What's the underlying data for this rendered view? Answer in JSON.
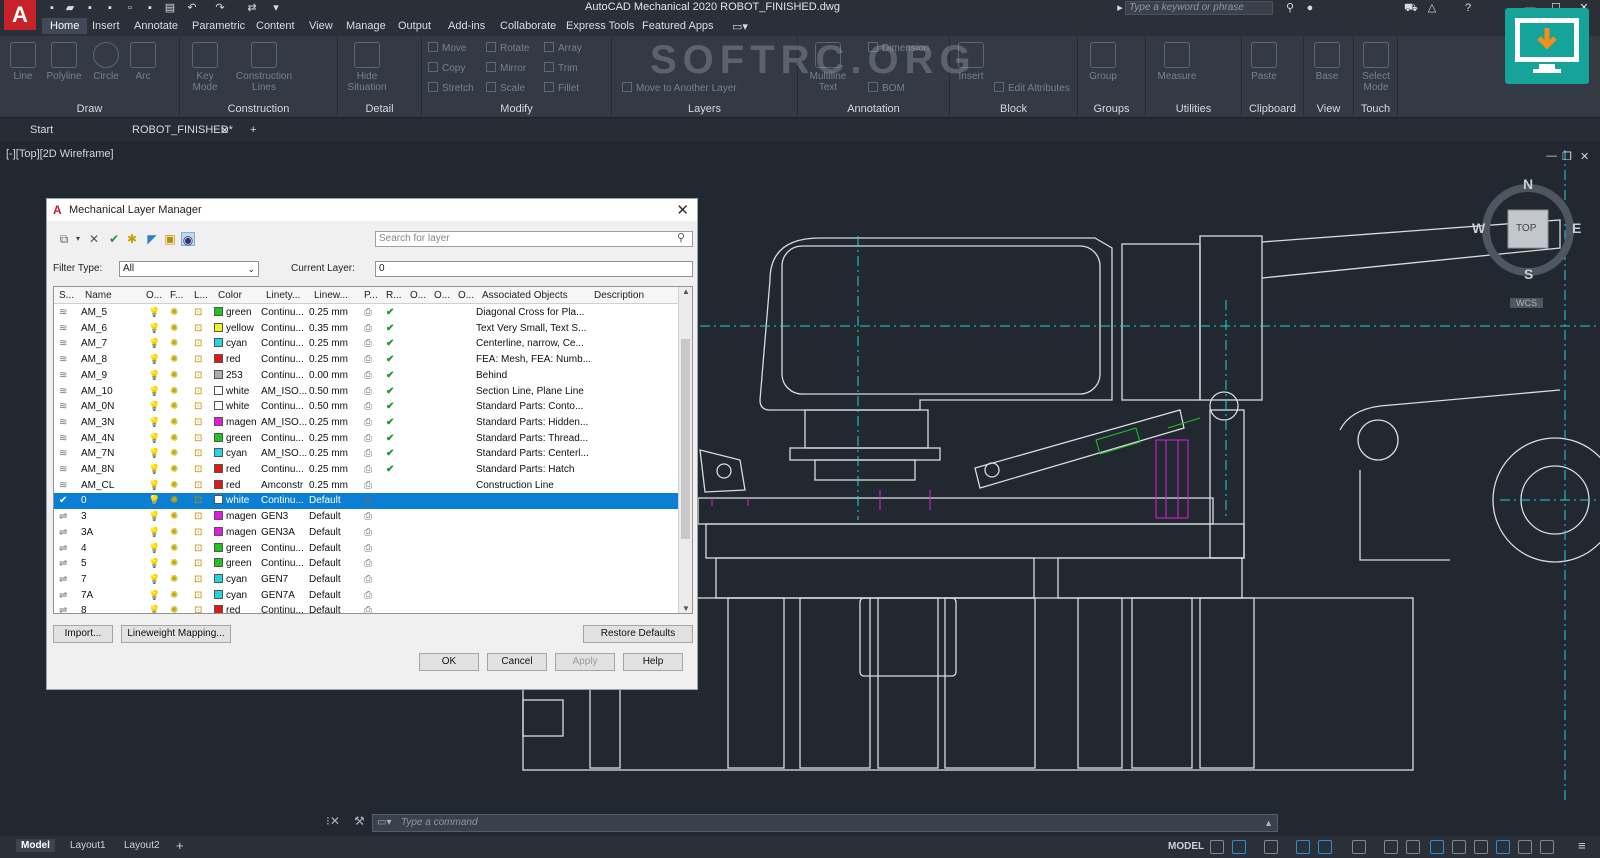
{
  "app": {
    "title": "AutoCAD Mechanical 2020    ROBOT_FINISHED.dwg",
    "logo": "A",
    "search_placeholder": "Type a keyword or phrase"
  },
  "ribbon_tabs": [
    "Home",
    "Insert",
    "Annotate",
    "Parametric",
    "Content",
    "View",
    "Manage",
    "Output",
    "Add-ins",
    "Collaborate",
    "Express Tools",
    "Featured Apps"
  ],
  "ribbon": {
    "draw": {
      "title": "Draw",
      "buttons": [
        "Line",
        "Polyline",
        "Circle",
        "Arc"
      ]
    },
    "construction": {
      "title": "Construction",
      "buttons": [
        "Key Mode",
        "Construction Lines"
      ]
    },
    "detail": {
      "title": "Detail",
      "buttons": [
        "Hide Situation"
      ]
    },
    "modify": {
      "title": "Modify",
      "buttons": [
        "Move",
        "Rotate",
        "Array",
        "Copy",
        "Mirror",
        "Trim",
        "Stretch",
        "Scale",
        "Fillet"
      ]
    },
    "layers": {
      "title": "Layers",
      "buttons": [
        "Move to Another Layer"
      ]
    },
    "annotation": {
      "title": "Annotation",
      "buttons": [
        "Dimension",
        "Multiline Text",
        "BOM"
      ]
    },
    "block": {
      "title": "Block",
      "buttons": [
        "Insert",
        "Edit Attributes"
      ]
    },
    "groups": {
      "title": "Groups",
      "buttons": [
        "Group"
      ]
    },
    "utilities": {
      "title": "Utilities",
      "buttons": [
        "Measure"
      ]
    },
    "clipboard": {
      "title": "Clipboard",
      "buttons": [
        "Paste"
      ]
    },
    "view": {
      "title": "View",
      "buttons": [
        "Base"
      ]
    },
    "touch": {
      "title": "Touch",
      "buttons": [
        "Select Mode"
      ]
    }
  },
  "watermark": "SOFTRC.ORG",
  "file_tabs": [
    "Start",
    "ROBOT_FINISHED*"
  ],
  "viewport_label": "[-][Top][2D Wireframe]",
  "viewcube": {
    "n": "N",
    "s": "S",
    "e": "E",
    "w": "W",
    "face": "TOP",
    "wcs": "WCS"
  },
  "dialog": {
    "title": "Mechanical Layer Manager",
    "search_placeholder": "Search for layer",
    "filter_type_label": "Filter Type:",
    "filter_type_value": "All",
    "current_layer_label": "Current Layer:",
    "current_layer_value": "0",
    "columns": [
      "S...",
      "Name",
      "O...",
      "F...",
      "L...",
      "Color",
      "Linety...",
      "Linew...",
      "P...",
      "R...",
      "O...",
      "O...",
      "O...",
      "Associated Objects",
      "Description"
    ],
    "rows": [
      {
        "name": "AM_5",
        "color": "green",
        "hex": "#1fc41f",
        "linetype": "Continu...",
        "lineweight": "0.25 mm",
        "checked": true,
        "assoc": "Diagonal Cross for Pla..."
      },
      {
        "name": "AM_6",
        "color": "yellow",
        "hex": "#f6f21c",
        "linetype": "Continu...",
        "lineweight": "0.35 mm",
        "checked": true,
        "assoc": "Text Very Small, Text S..."
      },
      {
        "name": "AM_7",
        "color": "cyan",
        "hex": "#22d6e0",
        "linetype": "Continu...",
        "lineweight": "0.25 mm",
        "checked": true,
        "assoc": "Centerline, narrow, Ce..."
      },
      {
        "name": "AM_8",
        "color": "red",
        "hex": "#e01818",
        "linetype": "Continu...",
        "lineweight": "0.25 mm",
        "checked": true,
        "assoc": "FEA: Mesh, FEA: Numb..."
      },
      {
        "name": "AM_9",
        "color": "253",
        "hex": "#adadad",
        "linetype": "Continu...",
        "lineweight": "0.00 mm",
        "checked": true,
        "assoc": "Behind"
      },
      {
        "name": "AM_10",
        "color": "white",
        "hex": "#ffffff",
        "linetype": "AM_ISO...",
        "lineweight": "0.50 mm",
        "checked": true,
        "assoc": "Section Line, Plane Line"
      },
      {
        "name": "AM_0N",
        "color": "white",
        "hex": "#ffffff",
        "linetype": "Continu...",
        "lineweight": "0.50 mm",
        "checked": true,
        "assoc": "Standard Parts: Conto..."
      },
      {
        "name": "AM_3N",
        "color": "magen",
        "hex": "#e01be0",
        "linetype": "AM_ISO...",
        "lineweight": "0.25 mm",
        "checked": true,
        "assoc": "Standard Parts: Hidden..."
      },
      {
        "name": "AM_4N",
        "color": "green",
        "hex": "#1fc41f",
        "linetype": "Continu...",
        "lineweight": "0.25 mm",
        "checked": true,
        "assoc": "Standard Parts: Thread..."
      },
      {
        "name": "AM_7N",
        "color": "cyan",
        "hex": "#22d6e0",
        "linetype": "AM_ISO...",
        "lineweight": "0.25 mm",
        "checked": true,
        "assoc": "Standard Parts: Centerl..."
      },
      {
        "name": "AM_8N",
        "color": "red",
        "hex": "#e01818",
        "linetype": "Continu...",
        "lineweight": "0.25 mm",
        "checked": true,
        "assoc": "Standard Parts: Hatch"
      },
      {
        "name": "AM_CL",
        "color": "red",
        "hex": "#e01818",
        "linetype": "Amconstr",
        "lineweight": "0.25 mm",
        "checked": false,
        "assoc": "Construction Line"
      },
      {
        "name": "0",
        "color": "white",
        "hex": "#ffffff",
        "linetype": "Continu...",
        "lineweight": "Default",
        "checked": false,
        "assoc": "",
        "selected": true
      },
      {
        "name": "3",
        "color": "magen",
        "hex": "#e01be0",
        "linetype": "GEN3",
        "lineweight": "Default",
        "checked": false,
        "assoc": ""
      },
      {
        "name": "3A",
        "color": "magen",
        "hex": "#e01be0",
        "linetype": "GEN3A",
        "lineweight": "Default",
        "checked": false,
        "assoc": ""
      },
      {
        "name": "4",
        "color": "green",
        "hex": "#1fc41f",
        "linetype": "Continu...",
        "lineweight": "Default",
        "checked": false,
        "assoc": ""
      },
      {
        "name": "5",
        "color": "green",
        "hex": "#1fc41f",
        "linetype": "Continu...",
        "lineweight": "Default",
        "checked": false,
        "assoc": ""
      },
      {
        "name": "7",
        "color": "cyan",
        "hex": "#22d6e0",
        "linetype": "GEN7",
        "lineweight": "Default",
        "checked": false,
        "assoc": ""
      },
      {
        "name": "7A",
        "color": "cyan",
        "hex": "#22d6e0",
        "linetype": "GEN7A",
        "lineweight": "Default",
        "checked": false,
        "assoc": ""
      },
      {
        "name": "8",
        "color": "red",
        "hex": "#e01818",
        "linetype": "Continu...",
        "lineweight": "Default",
        "checked": false,
        "assoc": ""
      }
    ],
    "buttons": {
      "import": "Import...",
      "lineweight_mapping": "Lineweight Mapping...",
      "restore_defaults": "Restore Defaults",
      "ok": "OK",
      "cancel": "Cancel",
      "apply": "Apply",
      "help": "Help"
    }
  },
  "command": {
    "placeholder": "Type a command"
  },
  "layout_tabs": [
    "Model",
    "Layout1",
    "Layout2"
  ],
  "status": {
    "model": "MODEL"
  }
}
